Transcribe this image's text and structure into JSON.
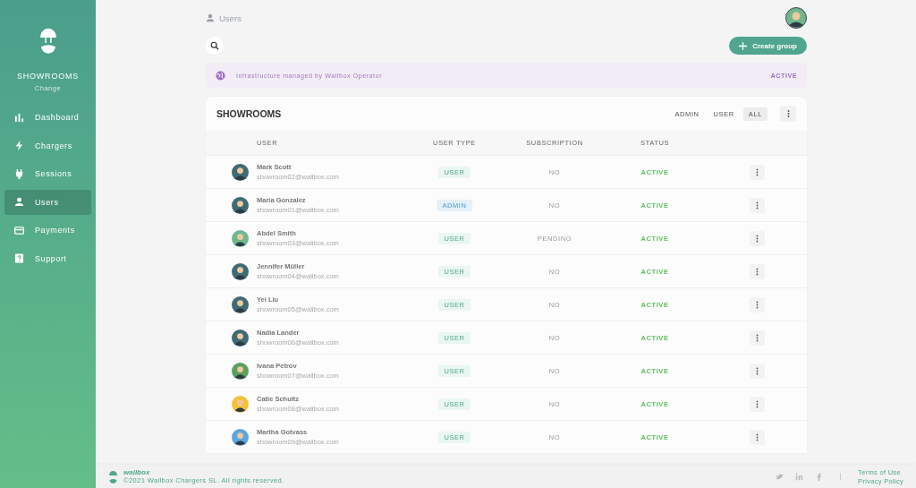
{
  "sidebar": {
    "org": "SHOWROOMS",
    "change": "Change",
    "items": [
      {
        "kind": "chart",
        "label": "Dashboard",
        "selected": false
      },
      {
        "kind": "bolt",
        "label": "Chargers",
        "selected": false
      },
      {
        "kind": "plug",
        "label": "Sessions",
        "selected": false
      },
      {
        "kind": "user",
        "label": "Users",
        "selected": true
      },
      {
        "kind": "card",
        "label": "Payments",
        "selected": false
      },
      {
        "kind": "help",
        "label": "Support",
        "selected": false
      }
    ]
  },
  "breadcrumb": "Users",
  "create_button": "Create group",
  "banner": {
    "text": "Infrastructure managed by Wallbox Operator",
    "status": "ACTIVE"
  },
  "group": {
    "title": "SHOWROOMS",
    "filters": [
      {
        "label": "ADMIN",
        "selected": false
      },
      {
        "label": "USER",
        "selected": false
      },
      {
        "label": "ALL",
        "selected": true
      }
    ]
  },
  "table": {
    "columns": [
      "USER",
      "USER TYPE",
      "SUBSCRIPTION",
      "STATUS"
    ],
    "rows": [
      {
        "name": "Mark Scott",
        "email": "showroom02@wallbox.com",
        "type": "USER",
        "subscription": "NO",
        "status": "ACTIVE",
        "color": "#3f6b74"
      },
      {
        "name": "Maria Gonzalez",
        "email": "showroom01@wallbox.com",
        "type": "ADMIN",
        "subscription": "NO",
        "status": "ACTIVE",
        "color": "#3f6b74"
      },
      {
        "name": "Abdel Smith",
        "email": "showroom03@wallbox.com",
        "type": "USER",
        "subscription": "PENDING",
        "status": "ACTIVE",
        "color": "#6fb88e"
      },
      {
        "name": "Jennifer Müller",
        "email": "showroom04@wallbox.com",
        "type": "USER",
        "subscription": "NO",
        "status": "ACTIVE",
        "color": "#3f6b74"
      },
      {
        "name": "Yei Liu",
        "email": "showroom05@wallbox.com",
        "type": "USER",
        "subscription": "NO",
        "status": "ACTIVE",
        "color": "#3f6b74"
      },
      {
        "name": "Nadia Lander",
        "email": "showroom06@wallbox.com",
        "type": "USER",
        "subscription": "NO",
        "status": "ACTIVE",
        "color": "#3f6b74"
      },
      {
        "name": "Ivana Petrov",
        "email": "showroom07@wallbox.com",
        "type": "USER",
        "subscription": "NO",
        "status": "ACTIVE",
        "color": "#5aa05e"
      },
      {
        "name": "Catie Schultz",
        "email": "showroom08@wallbox.com",
        "type": "USER",
        "subscription": "NO",
        "status": "ACTIVE",
        "color": "#f2c23a"
      },
      {
        "name": "Martha Gotvass",
        "email": "showroom09@wallbox.com",
        "type": "USER",
        "subscription": "NO",
        "status": "ACTIVE",
        "color": "#5aa6e0"
      }
    ]
  },
  "footer": {
    "brand": "wallbox",
    "copyright": "©2021 Wallbox Chargers SL. All rights reserved.",
    "links": [
      "Terms of Use",
      "Privacy Policy"
    ]
  }
}
